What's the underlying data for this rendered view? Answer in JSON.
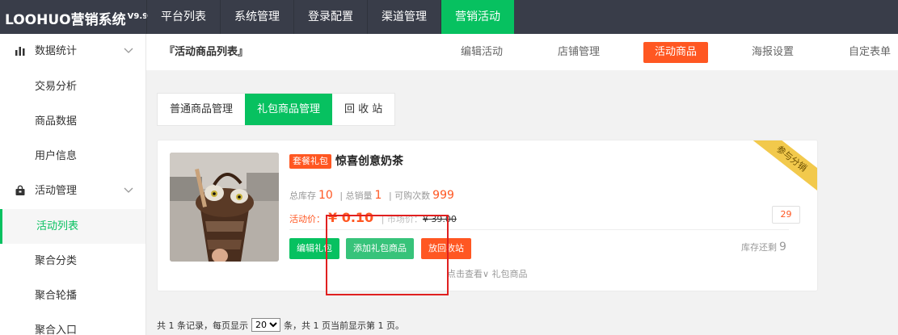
{
  "app": {
    "logo": "LOOHUO营销系统",
    "version": "V9.9"
  },
  "top_nav": [
    {
      "label": "平台列表",
      "active": false
    },
    {
      "label": "系统管理",
      "active": false
    },
    {
      "label": "登录配置",
      "active": false
    },
    {
      "label": "渠道管理",
      "active": false
    },
    {
      "label": "营销活动",
      "active": true
    }
  ],
  "sidebar": {
    "groups": [
      {
        "label": "数据统计",
        "icon": "bar-chart-icon",
        "items": [
          {
            "label": "交易分析",
            "active": false
          },
          {
            "label": "商品数据",
            "active": false
          },
          {
            "label": "用户信息",
            "active": false
          }
        ]
      },
      {
        "label": "活动管理",
        "icon": "bag-icon",
        "items": [
          {
            "label": "活动列表",
            "active": true
          },
          {
            "label": "聚合分类",
            "active": false
          },
          {
            "label": "聚合轮播",
            "active": false
          },
          {
            "label": "聚合入口",
            "active": false
          }
        ]
      }
    ]
  },
  "header": {
    "title": "『活动商品列表』",
    "sub_nav": [
      {
        "label": "编辑活动",
        "active": false
      },
      {
        "label": "店铺管理",
        "active": false
      },
      {
        "label": "活动商品",
        "active": true
      },
      {
        "label": "海报设置",
        "active": false
      },
      {
        "label": "自定表单",
        "active": false
      }
    ]
  },
  "tabs": [
    {
      "label": "普通商品管理",
      "active": false
    },
    {
      "label": "礼包商品管理",
      "active": true
    },
    {
      "label": "回 收 站",
      "active": false
    }
  ],
  "product": {
    "badge": "套餐礼包",
    "name": "惊喜创意奶茶",
    "ribbon": "参与分销",
    "stock_label": "总库存",
    "stock": "10",
    "sales_label": "| 总销量",
    "sales": "1",
    "buy_times_label": "| 可购次数",
    "buy_times": "999",
    "price_label": "活动价：",
    "price": "¥ 0.10",
    "market_price_label": "| 市场价：",
    "market_price": "¥ 39.00",
    "count": "29",
    "stock_left_label": "库存还剩",
    "stock_left": "9",
    "buttons": {
      "edit": "编辑礼包",
      "add": "添加礼包商品",
      "recycle": "放回收站"
    },
    "toggle": "点击查看∨ 礼包商品"
  },
  "pager": {
    "prefix": "共 1 条记录，每页显示",
    "page_size": "20",
    "suffix": "条，共 1 页当前显示第 1 页。"
  },
  "colors": {
    "accent": "#07c160",
    "warning": "#ff5722",
    "topbar": "#393d49"
  }
}
